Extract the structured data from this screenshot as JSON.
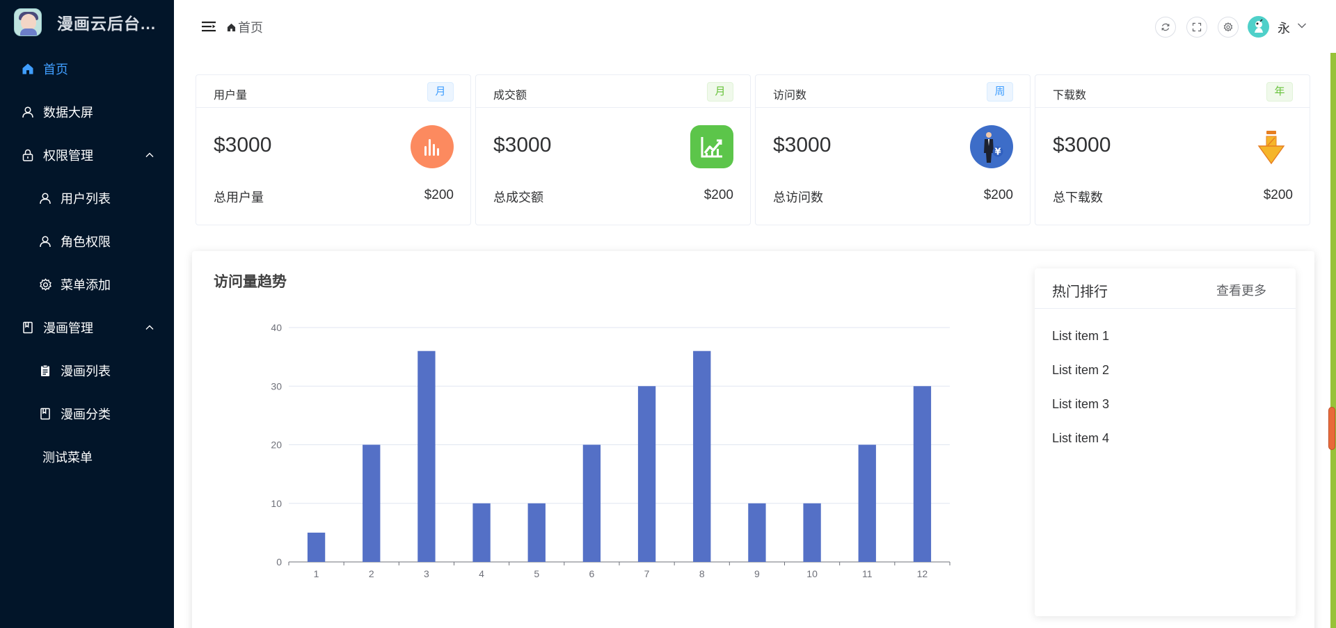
{
  "app": {
    "title": "漫画云后台..."
  },
  "sidebar": {
    "items": [
      {
        "label": "首页",
        "icon": "home-icon",
        "active": true
      },
      {
        "label": "数据大屏",
        "icon": "user-icon"
      },
      {
        "label": "权限管理",
        "icon": "lock-icon",
        "expanded": true
      },
      {
        "label": "用户列表",
        "icon": "user-icon"
      },
      {
        "label": "角色权限",
        "icon": "user-icon"
      },
      {
        "label": "菜单添加",
        "icon": "gear-icon"
      },
      {
        "label": "漫画管理",
        "icon": "book-icon",
        "expanded": true
      },
      {
        "label": "漫画列表",
        "icon": "clipboard-icon"
      },
      {
        "label": "漫画分类",
        "icon": "book-icon"
      },
      {
        "label": "测试菜单"
      }
    ]
  },
  "header": {
    "breadcrumb": "首页",
    "username": "永"
  },
  "cards": [
    {
      "title": "用户量",
      "tag": "月",
      "tag_color": "#409eff",
      "value": "$3000",
      "foot_label": "总用户量",
      "foot_value": "$200",
      "icon": "bar-chart-icon",
      "icon_color": "#fc8a5f"
    },
    {
      "title": "成交额",
      "tag": "月",
      "tag_color": "#67c23a",
      "value": "$3000",
      "foot_label": "总成交额",
      "foot_value": "$200",
      "icon": "line-chart-icon",
      "icon_color": "#5cc54a"
    },
    {
      "title": "访问数",
      "tag": "周",
      "tag_color": "#409eff",
      "value": "$3000",
      "foot_label": "总访问数",
      "foot_value": "$200",
      "icon": "businessman-yen-icon",
      "icon_color": "#3d6dc8"
    },
    {
      "title": "下载数",
      "tag": "年",
      "tag_color": "#67c23a",
      "value": "$3000",
      "foot_label": "总下载数",
      "foot_value": "$200",
      "icon": "download-arrow-icon",
      "icon_color": "#f5b52a"
    }
  ],
  "main": {
    "title": "访问量趋势"
  },
  "chart_data": {
    "type": "bar",
    "categories": [
      "1",
      "2",
      "3",
      "4",
      "5",
      "6",
      "7",
      "8",
      "9",
      "10",
      "11",
      "12"
    ],
    "values": [
      5,
      20,
      36,
      10,
      10,
      20,
      30,
      36,
      10,
      10,
      20,
      30
    ],
    "ylim": [
      0,
      40
    ],
    "yticks": [
      0,
      10,
      20,
      30,
      40
    ],
    "bar_color": "#5470c6",
    "grid": true
  },
  "hot": {
    "title": "热门排行",
    "more": "查看更多",
    "items": [
      "List item 1",
      "List item 2",
      "List item 3",
      "List item 4"
    ]
  }
}
